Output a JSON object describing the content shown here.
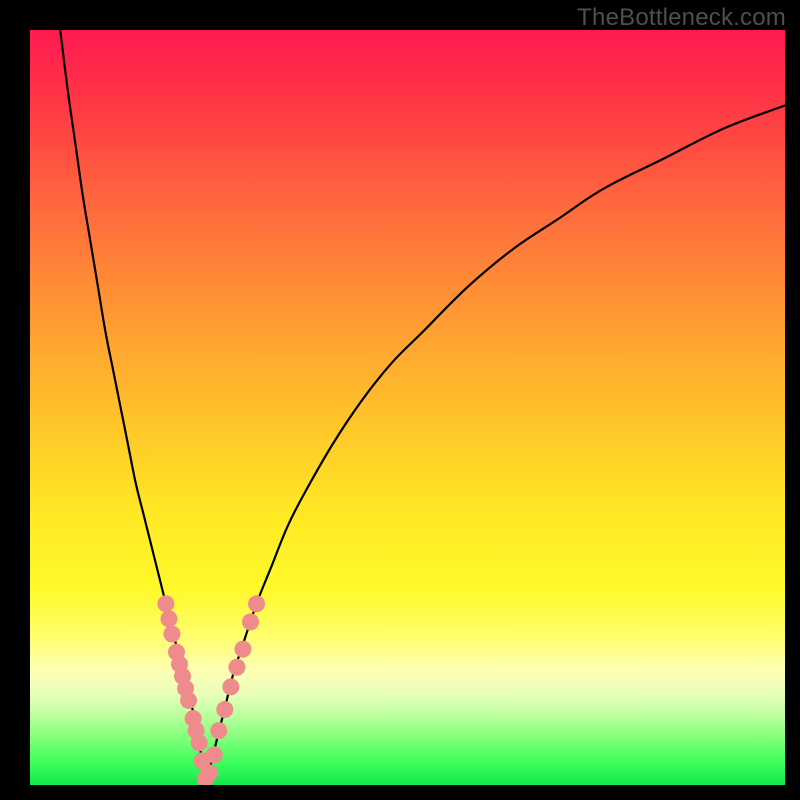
{
  "watermark": "TheBottleneck.com",
  "colors": {
    "curve_stroke": "#000000",
    "dot_fill": "#ef8b8d",
    "dot_stroke": "#d96a6c"
  },
  "chart_data": {
    "type": "line",
    "title": "",
    "xlabel": "",
    "ylabel": "",
    "xlim": [
      0,
      100
    ],
    "ylim": [
      0,
      100
    ],
    "series": [
      {
        "name": "left-curve",
        "x": [
          4,
          5,
          6,
          7,
          8,
          9,
          10,
          11,
          12,
          13,
          14,
          15,
          16,
          17,
          18,
          19,
          20,
          21,
          22,
          22.8,
          23.2
        ],
        "y": [
          100,
          92,
          85,
          78,
          72,
          66,
          60,
          55,
          50,
          45,
          40,
          36,
          32,
          28,
          24,
          20,
          16,
          12,
          8,
          3,
          0
        ]
      },
      {
        "name": "right-curve",
        "x": [
          23.2,
          24,
          25,
          26,
          27,
          28,
          30,
          32,
          34,
          36,
          40,
          44,
          48,
          52,
          58,
          64,
          70,
          76,
          84,
          92,
          100
        ],
        "y": [
          0,
          3,
          7,
          11,
          15,
          18,
          24,
          29,
          34,
          38,
          45,
          51,
          56,
          60,
          66,
          71,
          75,
          79,
          83,
          87,
          90
        ]
      }
    ],
    "points": {
      "name": "highlight-dots",
      "x": [
        18.0,
        18.4,
        18.8,
        19.4,
        19.8,
        20.2,
        20.6,
        21.0,
        21.6,
        22.0,
        22.4,
        22.8,
        23.2,
        23.8,
        24.4,
        25.0,
        25.8,
        26.6,
        27.4,
        28.2,
        29.2,
        30.0
      ],
      "y": [
        24.0,
        22.0,
        20.0,
        17.6,
        16.0,
        14.4,
        12.8,
        11.2,
        8.8,
        7.2,
        5.6,
        3.2,
        0.8,
        1.6,
        4.0,
        7.2,
        10.0,
        13.0,
        15.6,
        18.0,
        21.6,
        24.0
      ]
    }
  }
}
